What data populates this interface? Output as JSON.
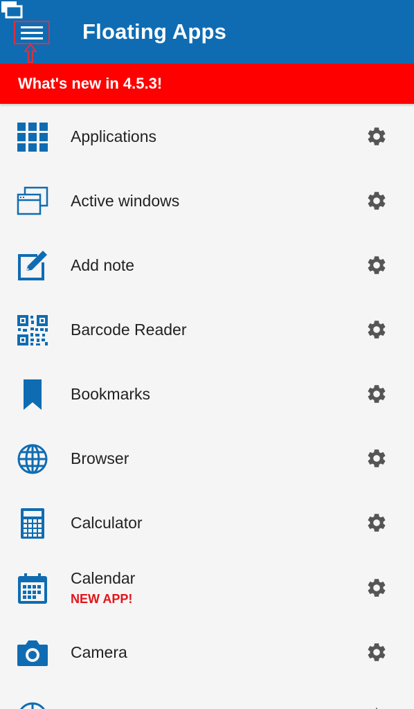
{
  "header": {
    "title": "Floating Apps",
    "menu_icon": "hamburger-menu-icon",
    "accent_color": "#0f6cb2"
  },
  "banner": {
    "text": "What's new in 4.5.3!",
    "color": "#ff0000"
  },
  "apps": [
    {
      "label": "Applications",
      "icon": "apps-grid-icon"
    },
    {
      "label": "Active windows",
      "icon": "windows-icon"
    },
    {
      "label": "Add note",
      "icon": "note-icon"
    },
    {
      "label": "Barcode Reader",
      "icon": "qr-code-icon"
    },
    {
      "label": "Bookmarks",
      "icon": "bookmark-icon"
    },
    {
      "label": "Browser",
      "icon": "globe-icon"
    },
    {
      "label": "Calculator",
      "icon": "calculator-icon"
    },
    {
      "label": "Calendar",
      "badge": "NEW APP!",
      "icon": "calendar-icon"
    },
    {
      "label": "Camera",
      "icon": "camera-icon"
    }
  ],
  "settings_icon": "gear-icon"
}
